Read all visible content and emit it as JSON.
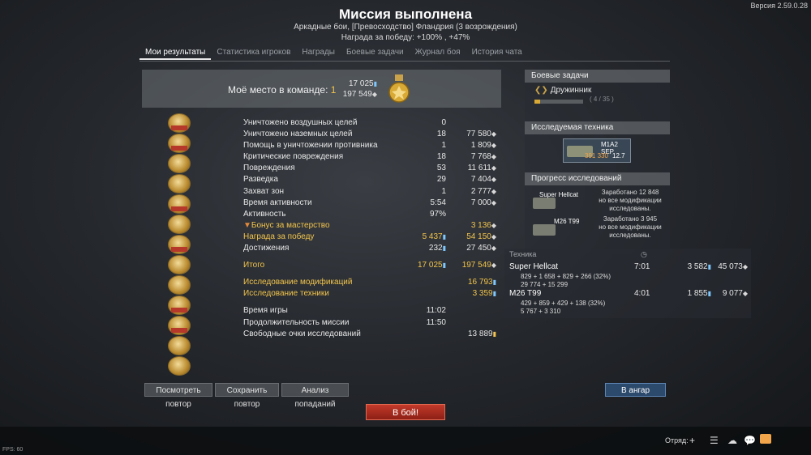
{
  "version": "Версия 2.59.0.28",
  "title": "Миссия выполнена",
  "subtitle": "Аркадные бои, [Превосходство] Фландрия (3 возрождения)",
  "reward": "Награда за победу: +100% , +47%",
  "tabs": [
    "Мои результаты",
    "Статистика игроков",
    "Награды",
    "Боевые задачи",
    "Журнал боя",
    "История чата"
  ],
  "place": {
    "label": "Моё место в команде:",
    "value": "1",
    "rp": "17 025",
    "sl": "197 549"
  },
  "stats": [
    {
      "label": "Уничтожено воздушных целей",
      "count": "0",
      "sl": ""
    },
    {
      "label": "Уничтожено наземных целей",
      "count": "18",
      "sl": "77 580"
    },
    {
      "label": "Помощь в уничтожении противника",
      "count": "1",
      "sl": "1 809"
    },
    {
      "label": "Критические повреждения",
      "count": "18",
      "sl": "7 768"
    },
    {
      "label": "Повреждения",
      "count": "53",
      "sl": "11 611"
    },
    {
      "label": "Разведка",
      "count": "29",
      "sl": "7 404"
    },
    {
      "label": "Захват зон",
      "count": "1",
      "sl": "2 777"
    },
    {
      "label": "Время активности",
      "count": "5:54",
      "sl": "7 000"
    },
    {
      "label": "Активность",
      "count": "97%",
      "sl": ""
    },
    {
      "label": "Бонус за мастерство",
      "count": "",
      "sl": "3 136"
    },
    {
      "label": "Награда за победу",
      "count": "5 437",
      "sl": "54 150"
    },
    {
      "label": "Достижения",
      "count": "232",
      "sl": "27 450"
    },
    {
      "label": "Итого",
      "count": "17 025",
      "sl": "197 549"
    },
    {
      "label": "Исследование модификаций",
      "count": "",
      "sl": "16 793"
    },
    {
      "label": "Исследование техники",
      "count": "",
      "sl": "3 359"
    },
    {
      "label": "Время игры",
      "count": "11:02",
      "sl": ""
    },
    {
      "label": "Продолжительность миссии",
      "count": "11:50",
      "sl": ""
    },
    {
      "label": "Свободные очки исследований",
      "count": "",
      "sl": "13 889"
    }
  ],
  "tasks": {
    "header": "Боевые задачи",
    "name": "Дружинник",
    "progress": "( 4 / 35 )",
    "fraction": 0.114
  },
  "research": {
    "header": "Исследуемая техника",
    "tank": "M1A2 SEP",
    "cost": "391 330",
    "br": "12.7"
  },
  "progress": {
    "header": "Прогресс исследований",
    "items": [
      {
        "tank": "Super Hellcat",
        "text1": "Заработано 12 848",
        "text2": "но все модификации",
        "text3": "исследованы."
      },
      {
        "tank": "M26 T99",
        "text1": "Заработано 3 945",
        "text2": "но все модификации",
        "text3": "исследованы."
      }
    ]
  },
  "vehicles": {
    "header": "Техника",
    "rows": [
      {
        "name": "Super Hellcat",
        "time": "7:01",
        "rp": "3 582",
        "sl": "45 073",
        "d1": "829 + 1 658 + 829 + 266 (32%)",
        "d2": "29 774 + 15 299"
      },
      {
        "name": "M26 T99",
        "time": "4:01",
        "rp": "1 855",
        "sl": "9 077",
        "d1": "429 + 859 + 429 + 138 (32%)",
        "d2": "5 767 + 3 310"
      }
    ]
  },
  "buttons": {
    "replay": "Посмотреть повтор",
    "save": "Сохранить повтор",
    "hits": "Анализ попаданий",
    "hangar": "В ангар",
    "battle": "В бой!"
  },
  "bottom": {
    "fps": "FPS: 60",
    "squad": "Отряд:"
  }
}
